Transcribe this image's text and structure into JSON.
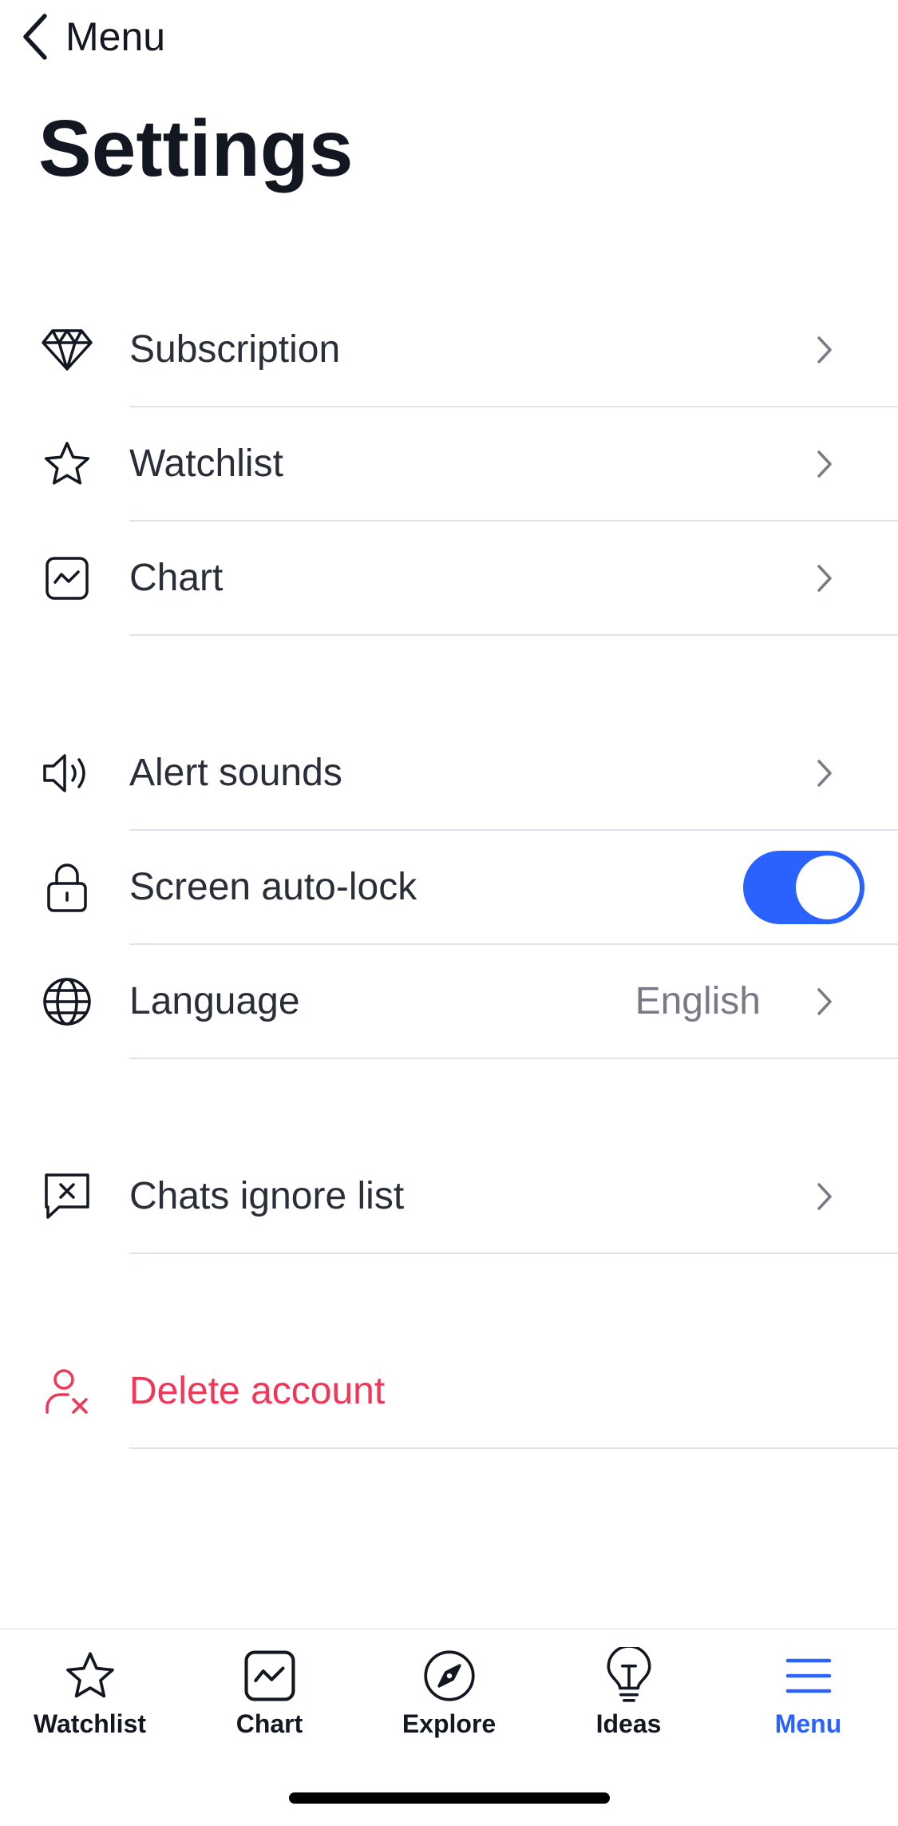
{
  "header": {
    "back_label": "Menu",
    "title": "Settings"
  },
  "sections": [
    {
      "items": [
        {
          "icon": "diamond-icon",
          "label": "Subscription",
          "control": "chevron"
        },
        {
          "icon": "star-icon",
          "label": "Watchlist",
          "control": "chevron"
        },
        {
          "icon": "chart-icon",
          "label": "Chart",
          "control": "chevron"
        }
      ]
    },
    {
      "items": [
        {
          "icon": "speaker-icon",
          "label": "Alert sounds",
          "control": "chevron"
        },
        {
          "icon": "lock-icon",
          "label": "Screen auto-lock",
          "control": "toggle",
          "toggle_on": true
        },
        {
          "icon": "globe-icon",
          "label": "Language",
          "value": "English",
          "control": "chevron"
        }
      ]
    },
    {
      "items": [
        {
          "icon": "chat-blocked-icon",
          "label": "Chats ignore list",
          "control": "chevron"
        }
      ]
    },
    {
      "items": [
        {
          "icon": "user-remove-icon",
          "label": "Delete account",
          "control": "none",
          "danger": true
        }
      ]
    }
  ],
  "tab_bar": {
    "tabs": [
      {
        "icon": "star-icon",
        "label": "Watchlist",
        "active": false
      },
      {
        "icon": "chart-icon",
        "label": "Chart",
        "active": false
      },
      {
        "icon": "compass-icon",
        "label": "Explore",
        "active": false
      },
      {
        "icon": "lightbulb-icon",
        "label": "Ideas",
        "active": false
      },
      {
        "icon": "hamburger-menu-icon",
        "label": "Menu",
        "active": true
      }
    ]
  },
  "colors": {
    "text_primary": "#131722",
    "text_secondary": "#787b86",
    "accent": "#2962ff",
    "danger": "#f23658",
    "divider": "#e0e3eb"
  }
}
